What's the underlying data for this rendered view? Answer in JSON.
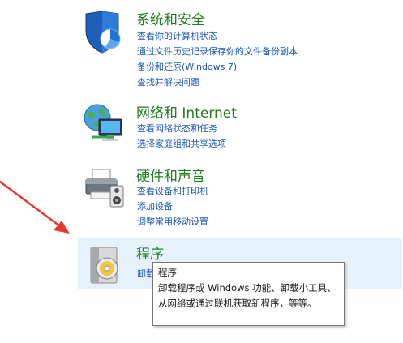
{
  "categories": {
    "security": {
      "title": "系统和安全",
      "links": [
        "查看你的计算机状态",
        "通过文件历史记录保存你的文件备份副本",
        "备份和还原(Windows 7)",
        "查找并解决问题"
      ]
    },
    "network": {
      "title": "网络和 Internet",
      "links": [
        "查看网络状态和任务",
        "选择家庭组和共享选项"
      ]
    },
    "hardware": {
      "title": "硬件和声音",
      "links": [
        "查看设备和打印机",
        "添加设备",
        "调整常用移动设置"
      ]
    },
    "programs": {
      "title": "程序",
      "links": [
        "卸载"
      ]
    }
  },
  "tooltip": {
    "title": "程序",
    "body": "卸载程序或 Windows 功能、卸载小工具、从网络或通过联机获取新程序，等等。"
  },
  "colors": {
    "category_title": "#1e7e1e",
    "link": "#1a57b8",
    "hover_background": "#e5f1fb",
    "annotation_arrow": "#e53935"
  }
}
